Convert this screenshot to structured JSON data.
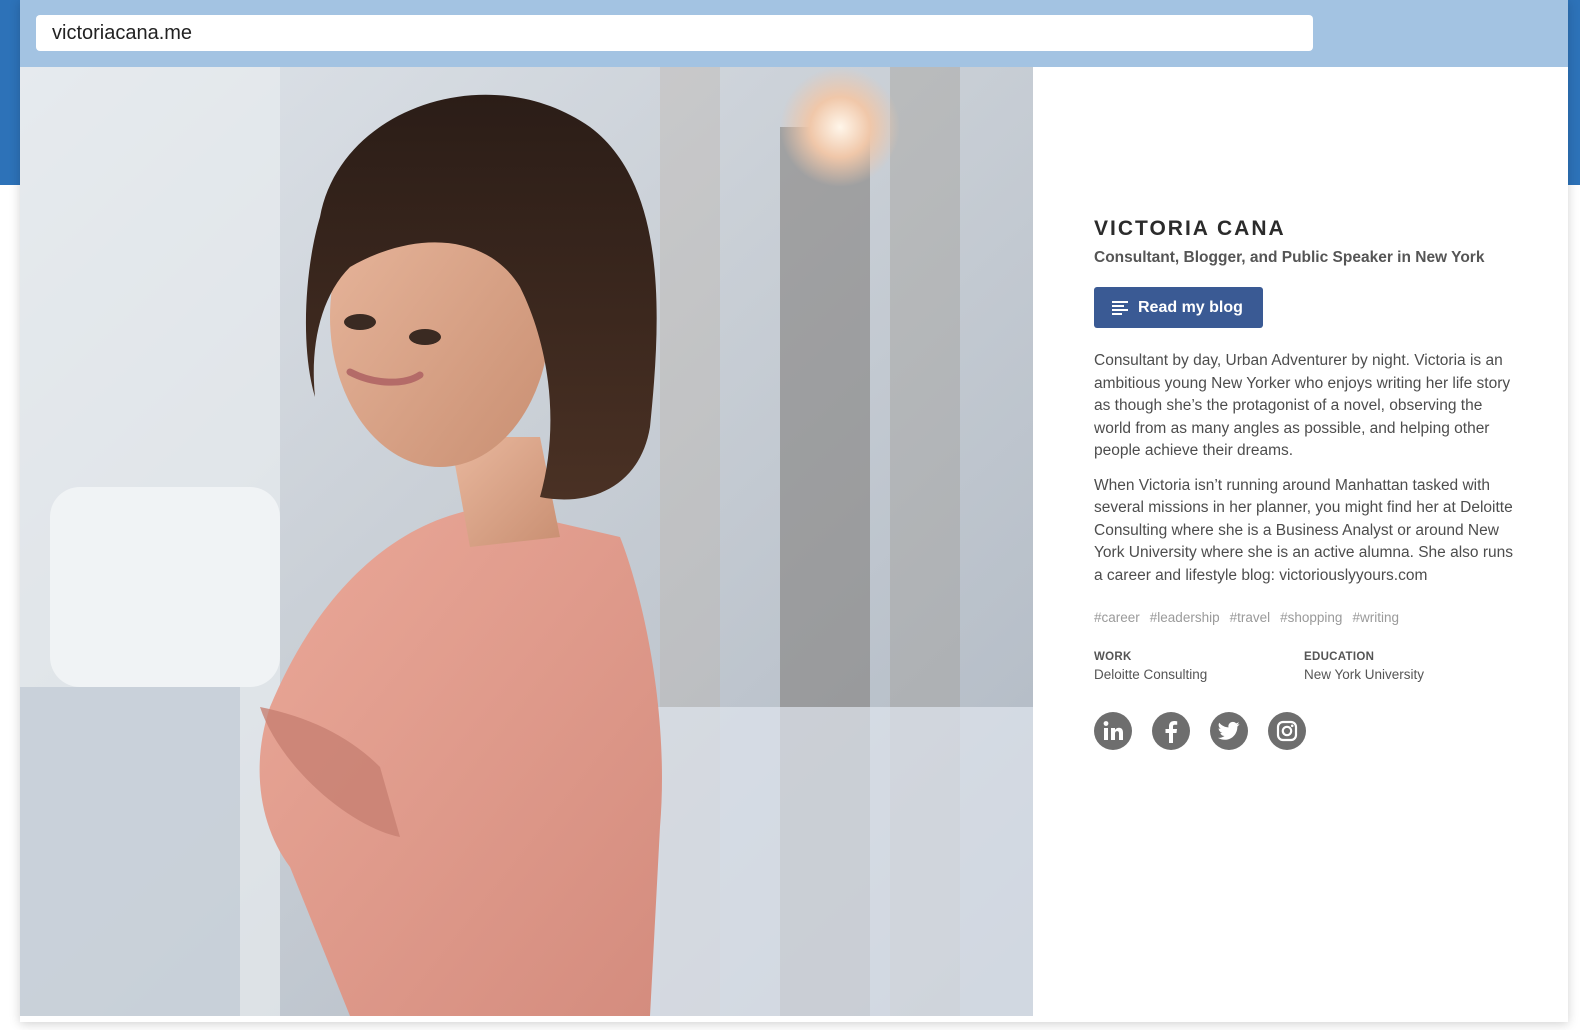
{
  "browser": {
    "url": "victoriacana.me"
  },
  "colors": {
    "accent": "#3a5a94",
    "brand_band": "#2d72b8",
    "browser_bar": "#a3c3e2",
    "icon_gray": "#6e6e6e"
  },
  "profile": {
    "name": "VICTORIA CANA",
    "tagline": "Consultant, Blogger, and Public Speaker in New York",
    "blog_button": {
      "label": "Read my blog",
      "icon": "menu-lines-icon"
    },
    "bio": [
      "Consultant by day, Urban Adventurer by night. Victoria is an ambitious young New Yorker who enjoys writing her life story as though she’s the protagonist of a novel, observing the world from as many angles as possible, and helping other people achieve their dreams.",
      "When Victoria isn’t running around Manhattan tasked with several missions in her planner, you might find her at Deloitte Consulting where she is a Business Analyst or around New York University where she is an active alumna. She also runs a career and lifestyle blog: victoriouslyyours.com"
    ],
    "tags": [
      "#career",
      "#leadership",
      "#travel",
      "#shopping",
      "#writing"
    ],
    "work": {
      "label": "WORK",
      "value": "Deloitte Consulting"
    },
    "education": {
      "label": "EDUCATION",
      "value": "New York University"
    },
    "social": [
      {
        "name": "linkedin-icon"
      },
      {
        "name": "facebook-icon"
      },
      {
        "name": "twitter-icon"
      },
      {
        "name": "instagram-icon"
      }
    ]
  }
}
